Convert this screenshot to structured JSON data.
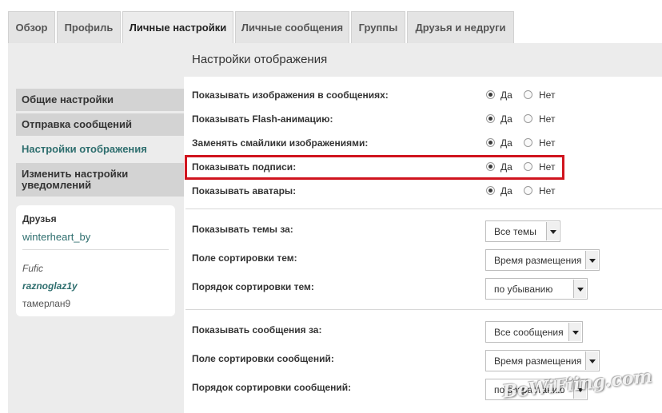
{
  "tabs": [
    "Обзор",
    "Профиль",
    "Личные настройки",
    "Личные сообщения",
    "Группы",
    "Друзья и недруги"
  ],
  "sidebar": {
    "items": [
      "Общие настройки",
      "Отправка сообщений",
      "Настройки отображения",
      "Изменить настройки уведомлений"
    ],
    "friends_title": "Друзья",
    "friend_primary": "winterheart_by",
    "friends_other": [
      "Fufic",
      "raznoglaz1y",
      "тамерлан9"
    ]
  },
  "main": {
    "title": "Настройки отображения",
    "yes": "Да",
    "no": "Нет",
    "radio_rows": [
      "Показывать изображения в сообщениях:",
      "Показывать Flash-анимацию:",
      "Заменять смайлики изображениями:",
      "Показывать подписи:",
      "Показывать аватары:"
    ],
    "select_rows": [
      {
        "label": "Показывать темы за:",
        "value": "Все темы"
      },
      {
        "label": "Поле сортировки тем:",
        "value": "Время размещения"
      },
      {
        "label": "Порядок сортировки тем:",
        "value": "по убыванию"
      },
      {
        "label": "Показывать сообщения за:",
        "value": "Все сообщения"
      },
      {
        "label": "Поле сортировки сообщений:",
        "value": "Время размещения"
      },
      {
        "label": "Порядок сортировки сообщений:",
        "value": "по возрастанию"
      }
    ]
  },
  "watermark": "BeWiFiing.com",
  "colors": {
    "accent": "#2e6e6e",
    "highlight": "#d0141e"
  }
}
